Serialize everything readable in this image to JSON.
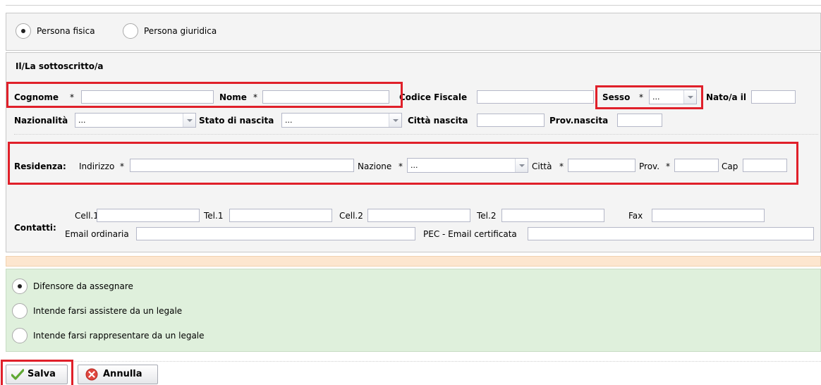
{
  "person_type": {
    "options": [
      "Persona fisica",
      "Persona giuridica"
    ],
    "selected": "Persona fisica"
  },
  "section_title": "Il/La sottoscritto/a",
  "anagrafica": {
    "cognome_label": "Cognome",
    "nome_label": "Nome",
    "codice_fiscale_label": "Codice Fiscale",
    "sesso_label": "Sesso",
    "sesso_value": "...",
    "nato_il_label": "Nato/a il",
    "nazionalita_label": "Nazionalità",
    "nazionalita_value": "...",
    "stato_nascita_label": "Stato di nascita",
    "stato_nascita_value": "...",
    "citta_nascita_label": "Città nascita",
    "prov_nascita_label": "Prov.nascita"
  },
  "residenza": {
    "title": "Residenza:",
    "indirizzo_label": "Indirizzo",
    "nazione_label": "Nazione",
    "nazione_value": "...",
    "citta_label": "Città",
    "prov_label": "Prov.",
    "cap_label": "Cap"
  },
  "contatti": {
    "title": "Contatti:",
    "cell1_label": "Cell.1",
    "tel1_label": "Tel.1",
    "cell2_label": "Cell.2",
    "tel2_label": "Tel.2",
    "fax_label": "Fax",
    "email_label": "Email ordinaria",
    "pec_label": "PEC - Email certificata"
  },
  "required_marker": "*",
  "difensore": {
    "options": [
      "Difensore da assegnare",
      "Intende farsi assistere da un legale",
      "Intende farsi rappresentare da un legale"
    ],
    "selected": "Difensore da assegnare"
  },
  "buttons": {
    "save": "Salva",
    "cancel": "Annulla"
  },
  "colors": {
    "highlight_border": "#e0202a",
    "section_bg": "#f4f4f4",
    "warning_strip": "#fde6cf",
    "options_bg": "#dff0dc"
  }
}
